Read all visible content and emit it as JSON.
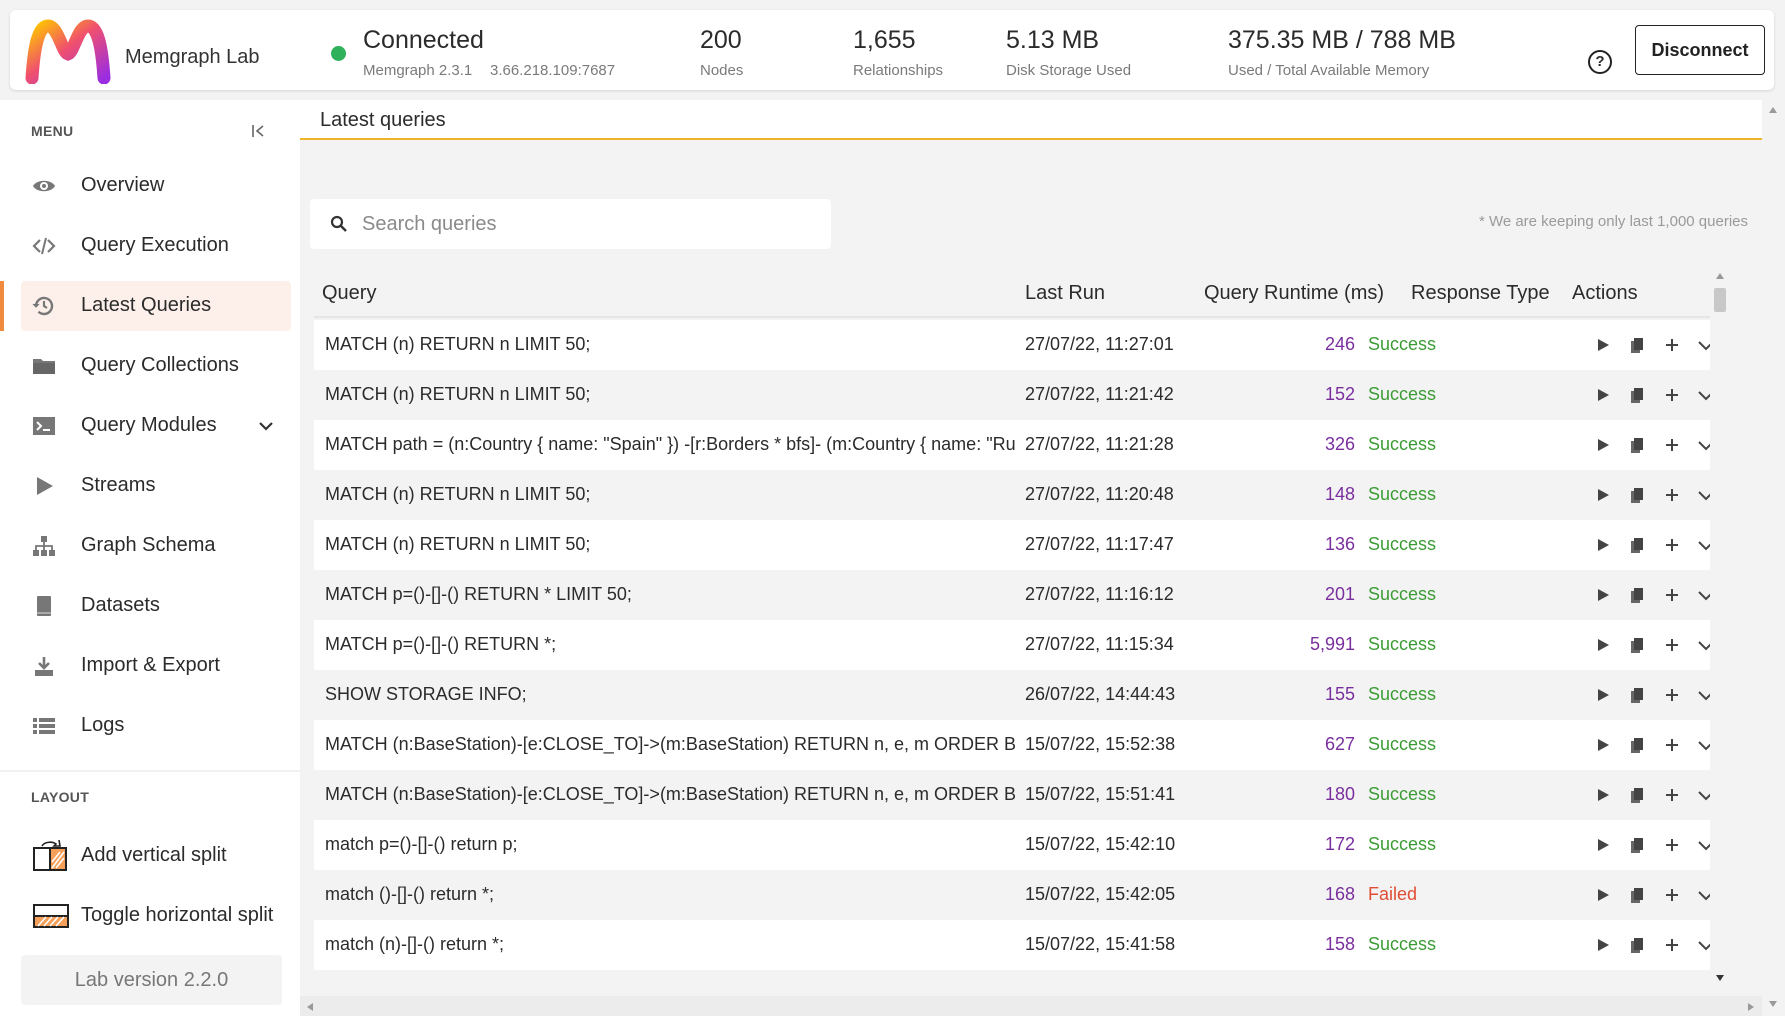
{
  "header": {
    "app_name": "Memgraph Lab",
    "status": "Connected",
    "version": "Memgraph 2.3.1",
    "address": "3.66.218.109:7687",
    "stats": [
      {
        "value": "200",
        "label": "Nodes"
      },
      {
        "value": "1,655",
        "label": "Relationships"
      },
      {
        "value": "5.13 MB",
        "label": "Disk Storage Used"
      },
      {
        "value": "375.35 MB / 788 MB",
        "label": "Used / Total Available Memory"
      }
    ],
    "help_icon": "?",
    "disconnect_label": "Disconnect",
    "status_color": "#2fb15b"
  },
  "sidebar": {
    "menu_title": "MENU",
    "items": [
      {
        "label": "Overview",
        "icon": "eye-icon"
      },
      {
        "label": "Query Execution",
        "icon": "code-icon"
      },
      {
        "label": "Latest Queries",
        "icon": "history-icon",
        "active": true
      },
      {
        "label": "Query Collections",
        "icon": "folder-icon"
      },
      {
        "label": "Query Modules",
        "icon": "terminal-icon"
      },
      {
        "label": "Streams",
        "icon": "play-icon"
      },
      {
        "label": "Graph Schema",
        "icon": "sitemap-icon"
      },
      {
        "label": "Datasets",
        "icon": "book-icon"
      },
      {
        "label": "Import & Export",
        "icon": "download-icon"
      },
      {
        "label": "Logs",
        "icon": "list-icon"
      }
    ],
    "layout_title": "LAYOUT",
    "layout_items": [
      {
        "label": "Add vertical split",
        "icon": "vertical-split-icon"
      },
      {
        "label": "Toggle horizontal split",
        "icon": "horizontal-split-icon"
      }
    ],
    "version": "Lab version 2.2.0",
    "accent_color": "#f08a3c"
  },
  "main": {
    "title": "Latest queries",
    "search_placeholder": "Search queries",
    "note": "* We are keeping only last 1,000 queries",
    "columns": [
      "Query",
      "Last Run",
      "Query Runtime (ms)",
      "Response Type",
      "Actions"
    ],
    "rows": [
      {
        "query": "MATCH (n) RETURN n LIMIT 50;",
        "last_run": "27/07/22, 11:27:01",
        "runtime": "246",
        "response": "Success"
      },
      {
        "query": "MATCH (n) RETURN n LIMIT 50;",
        "last_run": "27/07/22, 11:21:42",
        "runtime": "152",
        "response": "Success"
      },
      {
        "query": "MATCH path = (n:Country { name: \"Spain\" }) -[r:Borders * bfs]- (m:Country { name: \"Russia\" }) RETURN path;",
        "last_run": "27/07/22, 11:21:28",
        "runtime": "326",
        "response": "Success"
      },
      {
        "query": "MATCH (n) RETURN n LIMIT 50;",
        "last_run": "27/07/22, 11:20:48",
        "runtime": "148",
        "response": "Success"
      },
      {
        "query": "MATCH (n) RETURN n LIMIT 50;",
        "last_run": "27/07/22, 11:17:47",
        "runtime": "136",
        "response": "Success"
      },
      {
        "query": "MATCH p=()-[]-() RETURN * LIMIT 50;",
        "last_run": "27/07/22, 11:16:12",
        "runtime": "201",
        "response": "Success"
      },
      {
        "query": "MATCH p=()-[]-() RETURN *;",
        "last_run": "27/07/22, 11:15:34",
        "runtime": "5,991",
        "response": "Success"
      },
      {
        "query": "SHOW STORAGE INFO;",
        "last_run": "26/07/22, 14:44:43",
        "runtime": "155",
        "response": "Success"
      },
      {
        "query": "MATCH (n:BaseStation)-[e:CLOSE_TO]->(m:BaseStation) RETURN n, e, m ORDER BY e.weight;",
        "last_run": "15/07/22, 15:52:38",
        "runtime": "627",
        "response": "Success"
      },
      {
        "query": "MATCH (n:BaseStation)-[e:CLOSE_TO]->(m:BaseStation) RETURN n, e, m ORDER BY e.weight;",
        "last_run": "15/07/22, 15:51:41",
        "runtime": "180",
        "response": "Success"
      },
      {
        "query": "match p=()-[]-() return p;",
        "last_run": "15/07/22, 15:42:10",
        "runtime": "172",
        "response": "Success"
      },
      {
        "query": "match ()-[]-() return *;",
        "last_run": "15/07/22, 15:42:05",
        "runtime": "168",
        "response": "Failed"
      },
      {
        "query": "match (n)-[]-() return *;",
        "last_run": "15/07/22, 15:41:58",
        "runtime": "158",
        "response": "Success"
      }
    ],
    "row_actions": [
      "run-icon",
      "copy-icon",
      "add-icon",
      "expand-icon"
    ],
    "success_color": "#3c9c34",
    "failed_color": "#e04d34",
    "runtime_color": "#7a2f9e"
  }
}
